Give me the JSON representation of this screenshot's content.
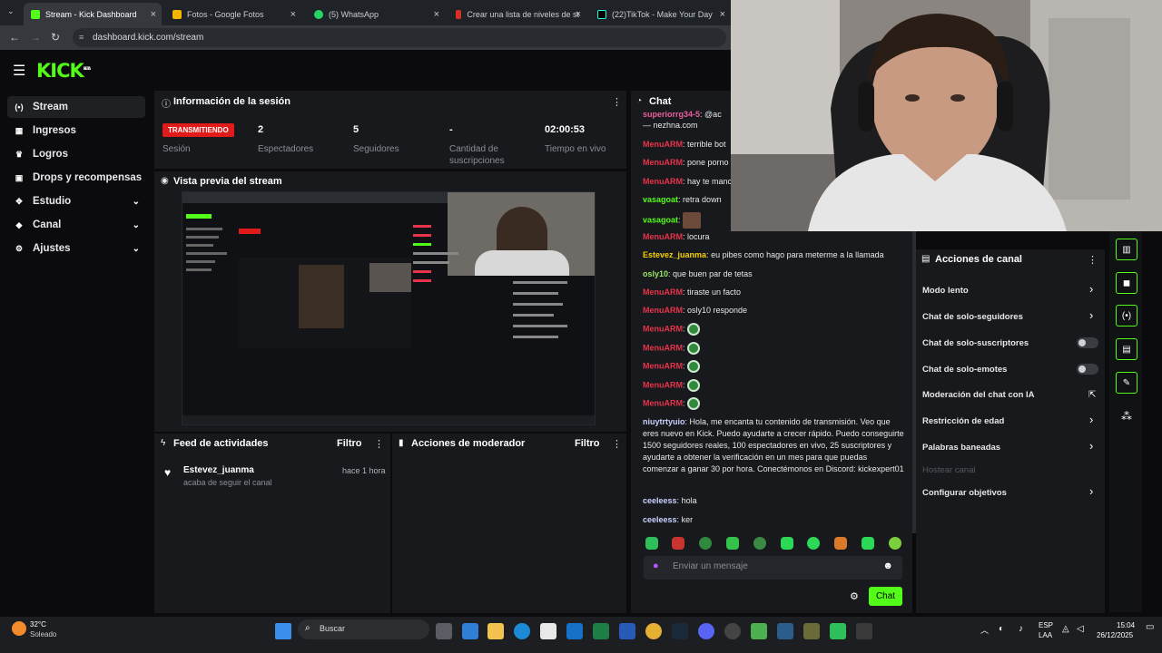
{
  "browser": {
    "tabs": [
      {
        "label": "Stream - Kick Dashboard",
        "color": "#53fc18"
      },
      {
        "label": "Fotos - Google Fotos",
        "color": "#f4b400"
      },
      {
        "label": "(5) WhatsApp",
        "color": "#25d366"
      },
      {
        "label": "Crear una lista de niveles de st",
        "color": "#d93025"
      },
      {
        "label": "(22)TikTok - Make Your Day",
        "color": "#000000"
      }
    ],
    "url": "dashboard.kick.com/stream"
  },
  "logo": {
    "text": "KICK",
    "tag": "BETA"
  },
  "sidebar": {
    "items": [
      {
        "label": "Stream",
        "icon": "broadcast-icon"
      },
      {
        "label": "Ingresos",
        "icon": "money-icon"
      },
      {
        "label": "Logros",
        "icon": "trophy-icon"
      },
      {
        "label": "Drops y recompensas",
        "icon": "gift-icon"
      },
      {
        "label": "Estudio",
        "icon": "studio-icon"
      },
      {
        "label": "Canal",
        "icon": "channel-icon"
      },
      {
        "label": "Ajustes",
        "icon": "gear-icon"
      }
    ]
  },
  "session": {
    "title": "Información de la sesión",
    "badge": "TRANSMITIENDO",
    "status_label": "Sesión",
    "viewers": "2",
    "viewers_label": "Espectadores",
    "followers": "5",
    "followers_label": "Seguidores",
    "subs": "-",
    "subs_label": "Cantidad de suscripciones",
    "uptime": "02:00:53",
    "uptime_label": "Tiempo en vivo"
  },
  "preview": {
    "title": "Vista previa del stream"
  },
  "activity": {
    "title": "Feed de actividades",
    "filter": "Filtro",
    "items": [
      {
        "user": "Estevez_juanma",
        "action": "acaba de seguir el canal",
        "time": "hace 1 hora"
      }
    ]
  },
  "mod_actions": {
    "title": "Acciones de moderador",
    "filter": "Filtro"
  },
  "chat": {
    "title": "Chat",
    "messages": [
      {
        "user": "superiorrg34-5",
        "text": "@ac",
        "color": "#e85d9b"
      },
      {
        "user": "",
        "text": "— nezhna.com",
        "color": "#e85d9b"
      },
      {
        "user": "MenuARM",
        "text": "terrible bot",
        "color": "#e8334a"
      },
      {
        "user": "MenuARM",
        "text": "pone porno",
        "color": "#e8334a"
      },
      {
        "user": "MenuARM",
        "text": "hay te manc",
        "color": "#e8334a"
      },
      {
        "user": "vasagoat",
        "text": "retra down",
        "color": "#53fc18"
      },
      {
        "user": "vasagoat",
        "text": "",
        "color": "#53fc18"
      },
      {
        "user": "MenuARM",
        "text": "locura",
        "color": "#e8334a"
      },
      {
        "user": "Estevez_juanma",
        "text": "eu pibes como hago para meterme a la llamada",
        "color": "#f5d000"
      },
      {
        "user": "osly10",
        "text": "que buen par de tetas",
        "color": "#9be66a"
      },
      {
        "user": "MenuARM",
        "text": "tiraste un facto",
        "color": "#e8334a"
      },
      {
        "user": "MenuARM",
        "text": "osly10 responde",
        "color": "#e8334a"
      }
    ],
    "long_message": {
      "user": "niuytrtyuio",
      "text": "Hola, me encanta tu contenido de transmisión. Veo que eres nuevo en Kick. Puedo ayudarte a crecer rápido. Puedo conseguirte 1500 seguidores reales, 100 espectadores en vivo, 25 suscriptores y ayudarte a obtener la verificación en un mes para que puedas comenzar a ganar 30 por hora. Conectémonos en Discord: kickexpert01",
      "color": "#c9d2ff"
    },
    "tail": [
      {
        "user": "ceeleess",
        "text": "hola",
        "color": "#c9d2ff"
      },
      {
        "user": "ceeleess",
        "text": "ker",
        "color": "#c9d2ff"
      }
    ],
    "emote_user": "MenuARM",
    "placeholder": "Enviar un mensaje",
    "send": "Chat"
  },
  "channel_actions": {
    "title": "Acciones de canal",
    "items": [
      {
        "label": "Modo lento",
        "kind": "chevron"
      },
      {
        "label": "Chat de solo-seguidores",
        "kind": "chevron"
      },
      {
        "label": "Chat de solo-suscriptores",
        "kind": "toggle"
      },
      {
        "label": "Chat de solo-emotes",
        "kind": "toggle"
      },
      {
        "label": "Moderación del chat con IA",
        "kind": "external"
      },
      {
        "label": "Restricción de edad",
        "kind": "chevron"
      },
      {
        "label": "Palabras baneadas",
        "kind": "chevron"
      },
      {
        "label": "Hostear canal",
        "kind": "disabled"
      },
      {
        "label": "Configurar objetivos",
        "kind": "chevron"
      }
    ]
  },
  "taskbar": {
    "weather_temp": "32°C",
    "weather_desc": "Soleado",
    "search": "Buscar",
    "lang": "ESP",
    "lang2": "LAA",
    "time": "15:04",
    "date": "26/12/2025"
  }
}
